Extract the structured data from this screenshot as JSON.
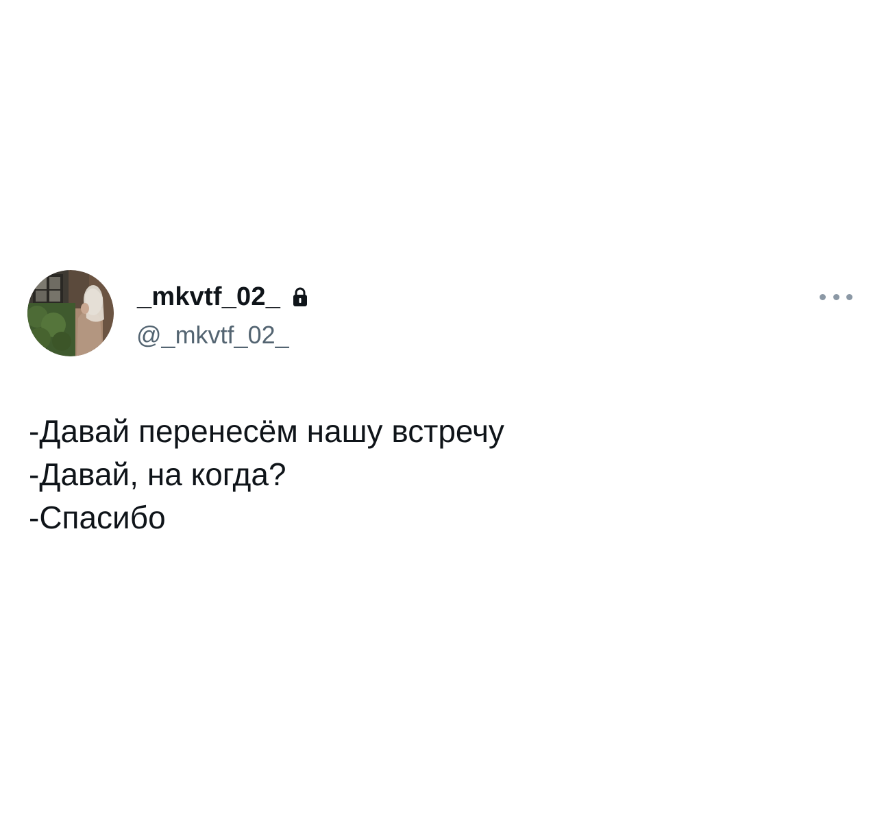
{
  "tweet": {
    "author": {
      "display_name": "_mkvtf_02_",
      "handle": "@_mkvtf_02_",
      "protected_icon": "lock-icon",
      "avatar": "profile photo"
    },
    "more_icon": "more-horizontal-icon",
    "lines": [
      "-Давай перенесём нашу встречу",
      "-Давай, на когда?",
      "-Спасибо"
    ]
  },
  "colors": {
    "background": "#ffffff",
    "text_primary": "#0f1419",
    "text_secondary": "#536471",
    "icon_muted": "#8b98a5"
  }
}
